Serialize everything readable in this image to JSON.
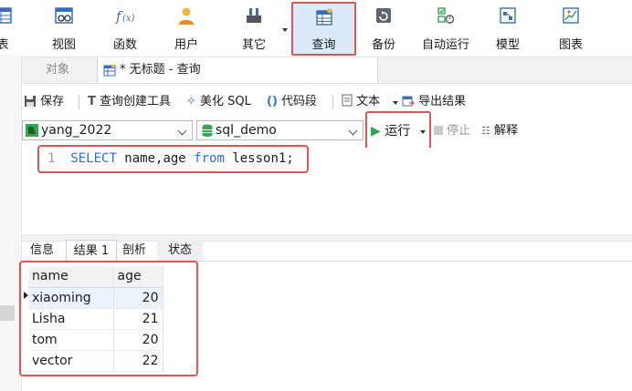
{
  "ribbon": {
    "items": [
      {
        "label": "表",
        "icon": "table-icon"
      },
      {
        "label": "视图",
        "icon": "view-icon"
      },
      {
        "label": "函数",
        "icon": "function-icon"
      },
      {
        "label": "用户",
        "icon": "user-icon"
      },
      {
        "label": "其它",
        "icon": "tools-icon"
      },
      {
        "label": "查询",
        "icon": "query-icon",
        "active": true
      },
      {
        "label": "备份",
        "icon": "backup-icon"
      },
      {
        "label": "自动运行",
        "icon": "automation-icon"
      },
      {
        "label": "模型",
        "icon": "model-icon"
      },
      {
        "label": "图表",
        "icon": "chart-icon"
      }
    ]
  },
  "tabs": {
    "objects": "对象",
    "query": "* 无标题 - 查询"
  },
  "toolbar": {
    "save": "保存",
    "query_builder": "查询创建工具",
    "beautify": "美化 SQL",
    "snippet": "代码段",
    "text": "文本",
    "export": "导出结果"
  },
  "connection": {
    "name": "yang_2022",
    "database": "sql_demo",
    "run": "运行",
    "stop": "停止",
    "explain": "解释"
  },
  "editor": {
    "line_number": "1",
    "sql": {
      "select": "SELECT",
      "columns": " name,age ",
      "from": "from",
      "table": " lesson1;"
    }
  },
  "result_tabs": [
    "信息",
    "结果 1",
    "剖析",
    "状态"
  ],
  "results": {
    "columns": [
      "name",
      "age"
    ],
    "rows": [
      [
        "xiaoming",
        "20"
      ],
      [
        "Lisha",
        "21"
      ],
      [
        "tom",
        "20"
      ],
      [
        "vector",
        "22"
      ]
    ]
  },
  "colors": {
    "highlight_border": "#e05454",
    "keyword": "#2f6fd8",
    "run_green": "#2fa84f",
    "active_ribbon": "#dbe9f8"
  }
}
